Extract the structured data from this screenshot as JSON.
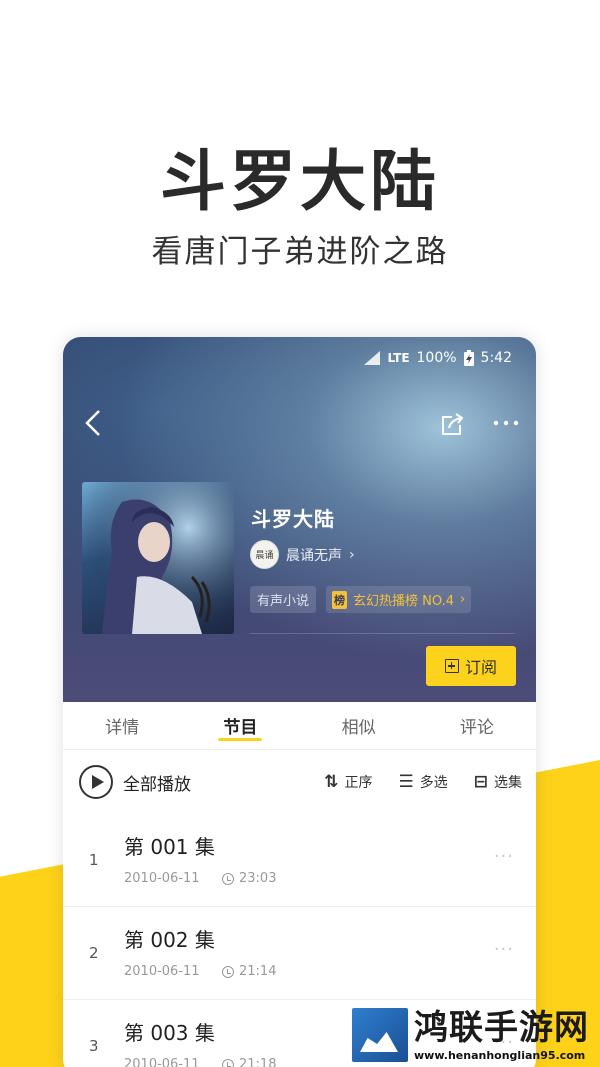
{
  "promo": {
    "title": "斗罗大陆",
    "subtitle": "看唐门子弟进阶之路"
  },
  "status_bar": {
    "network": "LTE",
    "battery": "100%",
    "time": "5:42"
  },
  "book": {
    "title": "斗罗大陆",
    "author": "晨诵无声",
    "avatar_text": "晨诵",
    "genre_tag": "有声小说",
    "rank_badge": "榜",
    "rank_text": "玄幻热播榜 NO.4",
    "subscribe_label": "订阅"
  },
  "tabs": [
    {
      "label": "详情"
    },
    {
      "label": "节目"
    },
    {
      "label": "相似"
    },
    {
      "label": "评论"
    }
  ],
  "toolbar": {
    "play_all": "全部播放",
    "sort": "正序",
    "multi_select": "多选",
    "select_episode": "选集"
  },
  "episodes": [
    {
      "index": "1",
      "title": "第 001 集",
      "date": "2010-06-11",
      "duration": "23:03"
    },
    {
      "index": "2",
      "title": "第 002 集",
      "date": "2010-06-11",
      "duration": "21:14"
    },
    {
      "index": "3",
      "title": "第 003 集",
      "date": "2010-06-11",
      "duration": "21:18"
    }
  ],
  "watermark": {
    "title": "鸿联手游网",
    "url": "www.henanhonglian95.com"
  },
  "icons": {
    "back": "chevron-left-icon",
    "share": "share-icon",
    "more": "more-icon",
    "play": "play-icon",
    "sort": "sort-icon",
    "multi_select": "multi-select-icon",
    "select": "select-icon",
    "clock": "clock-icon"
  },
  "colors": {
    "accent": "#fcd21c",
    "rank_text": "#f3c13a"
  }
}
